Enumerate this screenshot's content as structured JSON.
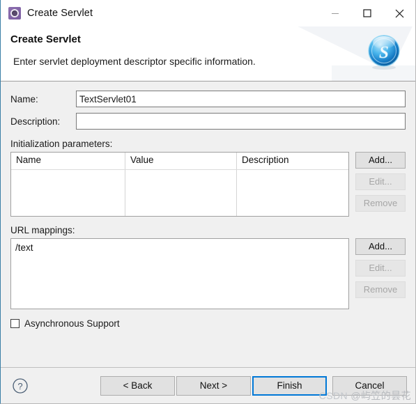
{
  "window": {
    "title": "Create Servlet",
    "icon": "servlet-gear-icon",
    "controls": {
      "minimize": "minimize-icon",
      "maximize": "maximize-icon",
      "close": "close-icon"
    }
  },
  "banner": {
    "title": "Create Servlet",
    "description": "Enter servlet deployment descriptor specific information.",
    "badge_icon": "blue-servlet-s-badge",
    "badge_letter": "S"
  },
  "form": {
    "name": {
      "label": "Name:",
      "value": "TextServlet01",
      "placeholder": ""
    },
    "description": {
      "label": "Description:",
      "value": "",
      "placeholder": ""
    }
  },
  "init_params": {
    "label": "Initialization parameters:",
    "columns": [
      "Name",
      "Value",
      "Description"
    ],
    "rows": [],
    "buttons": [
      {
        "label": "Add...",
        "enabled": true
      },
      {
        "label": "Edit...",
        "enabled": false
      },
      {
        "label": "Remove",
        "enabled": false
      }
    ]
  },
  "url_mappings": {
    "label": "URL mappings:",
    "items": [
      "/text"
    ],
    "buttons": [
      {
        "label": "Add...",
        "enabled": true
      },
      {
        "label": "Edit...",
        "enabled": false
      },
      {
        "label": "Remove",
        "enabled": false
      }
    ]
  },
  "async_support": {
    "label": "Asynchronous Support",
    "checked": false
  },
  "footer": {
    "help_icon": "help-question-icon",
    "back": "< Back",
    "next": "Next >",
    "finish": "Finish",
    "cancel": "Cancel",
    "focused": "Finish"
  },
  "watermark": {
    "brand": "CSDN",
    "user": "@屿笠的昙花"
  },
  "colors": {
    "accent": "#0078d7",
    "dialog_bg": "#f0f0f0",
    "title_icon": "#7a5ca0",
    "badge": "#1d9bdb"
  }
}
